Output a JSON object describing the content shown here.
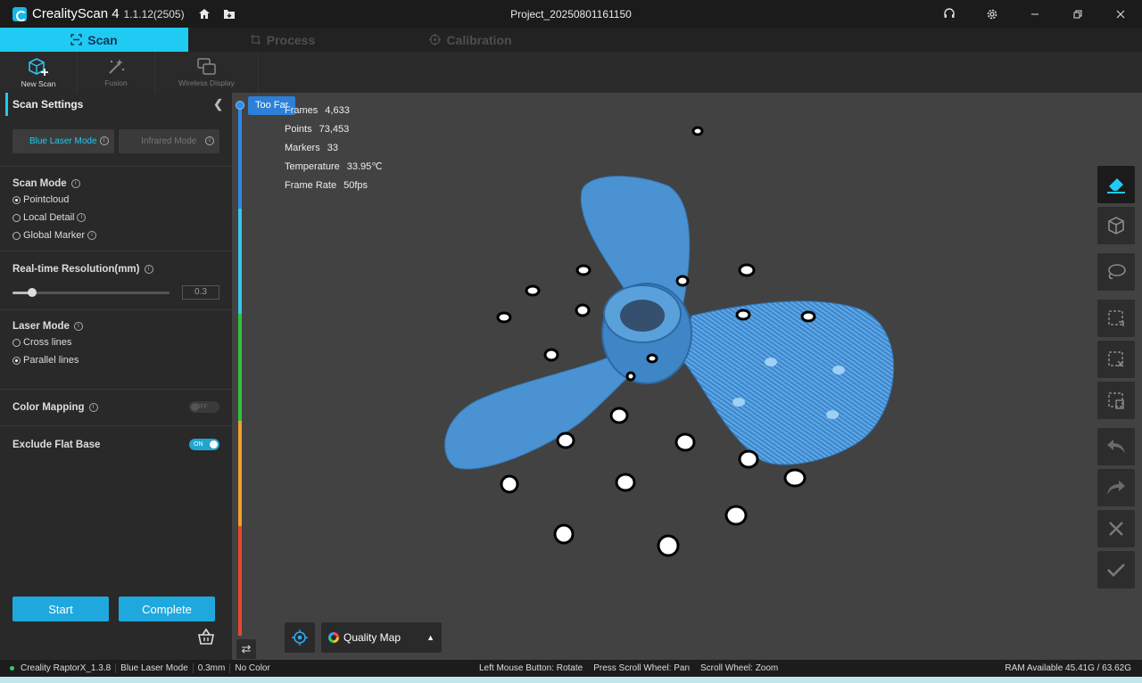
{
  "titlebar": {
    "app_name": "CrealityScan 4",
    "version": "1.1.12(2505)",
    "project": "Project_20250801161150"
  },
  "tabs": [
    {
      "label": "Scan"
    },
    {
      "label": "Process"
    },
    {
      "label": "Calibration"
    }
  ],
  "toolbar": {
    "new_scan": "New Scan",
    "fusion": "Fusion",
    "wireless": "Wireless Display"
  },
  "panel": {
    "title": "Scan Settings",
    "blue_laser": "Blue Laser Mode",
    "infrared": "Infrared Mode",
    "scan_mode": {
      "title": "Scan Mode",
      "options": [
        "Pointcloud",
        "Local Detail",
        "Global Marker"
      ],
      "selected": 0
    },
    "resolution": {
      "title": "Real-time Resolution(mm)",
      "value": "0.3",
      "fraction": 0.12
    },
    "laser_mode": {
      "title": "Laser Mode",
      "options": [
        "Cross lines",
        "Parallel lines"
      ],
      "selected": 1
    },
    "color_mapping": {
      "title": "Color Mapping",
      "state": "OFF"
    },
    "flat_base": {
      "title": "Exclude Flat Base",
      "state": "ON"
    },
    "start": "Start",
    "complete": "Complete"
  },
  "viewport": {
    "too_far": "Too Far",
    "stats": [
      {
        "label": "Frames",
        "value": "4,633"
      },
      {
        "label": "Points",
        "value": "73,453"
      },
      {
        "label": "Markers",
        "value": "33"
      },
      {
        "label": "Temperature",
        "value": "33.95℃"
      },
      {
        "label": "Frame Rate",
        "value": "50fps"
      }
    ],
    "quality_map": "Quality Map",
    "distance_colors": [
      "#2d86e8",
      "#33c7e8",
      "#2ec23c",
      "#f0a02a",
      "#e8472d"
    ]
  },
  "status": {
    "device": "Creality RaptorX_1.3.8",
    "mode": "Blue Laser Mode",
    "resolution": "0.3mm",
    "color": "No Color",
    "hint_rotate": "Left Mouse Button: Rotate",
    "hint_pan": "Press Scroll Wheel: Pan",
    "hint_zoom": "Scroll Wheel: Zoom",
    "ram": "RAM Available 45.41G / 63.62G"
  }
}
